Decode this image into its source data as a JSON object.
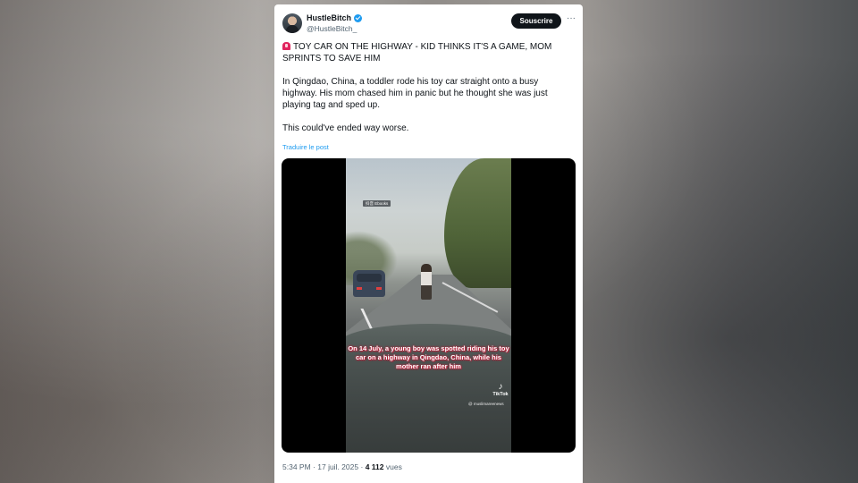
{
  "author": {
    "name": "HustleBitch",
    "handle": "@HustleBitch_"
  },
  "follow_label": "Souscrire",
  "more_label": "···",
  "post": {
    "headline": "TOY CAR ON THE HIGHWAY - KID THINKS IT'S A GAME, MOM SPRINTS TO SAVE HIM",
    "body": "In Qingdao, China, a toddler rode his toy car straight onto a busy highway. His mom chased him in panic but he thought she was just playing tag and sped up.",
    "closing": "This could've ended way worse.",
    "translate_label": "Traduire le post"
  },
  "video": {
    "watermark_tag": "抖音 Ebooks",
    "caption": "On 14 July, a young boy was spotted riding his toy car on a highway in Qingdao, China, while his mother ran after him",
    "tiktok_label": "TikTok",
    "tiktok_user": "@ muslimareenews"
  },
  "meta": {
    "time": "5:34 PM",
    "separator": "·",
    "date": "17 juil. 2025",
    "views_count": "4 112",
    "views_label": "vues"
  },
  "icons": {
    "verified": "verified-badge-icon",
    "siren": "rotating-light-icon",
    "more": "more-options-icon",
    "tiktok": "tiktok-logo-icon"
  },
  "colors": {
    "accent": "#1d9bf0",
    "text": "#0f1419",
    "muted": "#536471"
  }
}
